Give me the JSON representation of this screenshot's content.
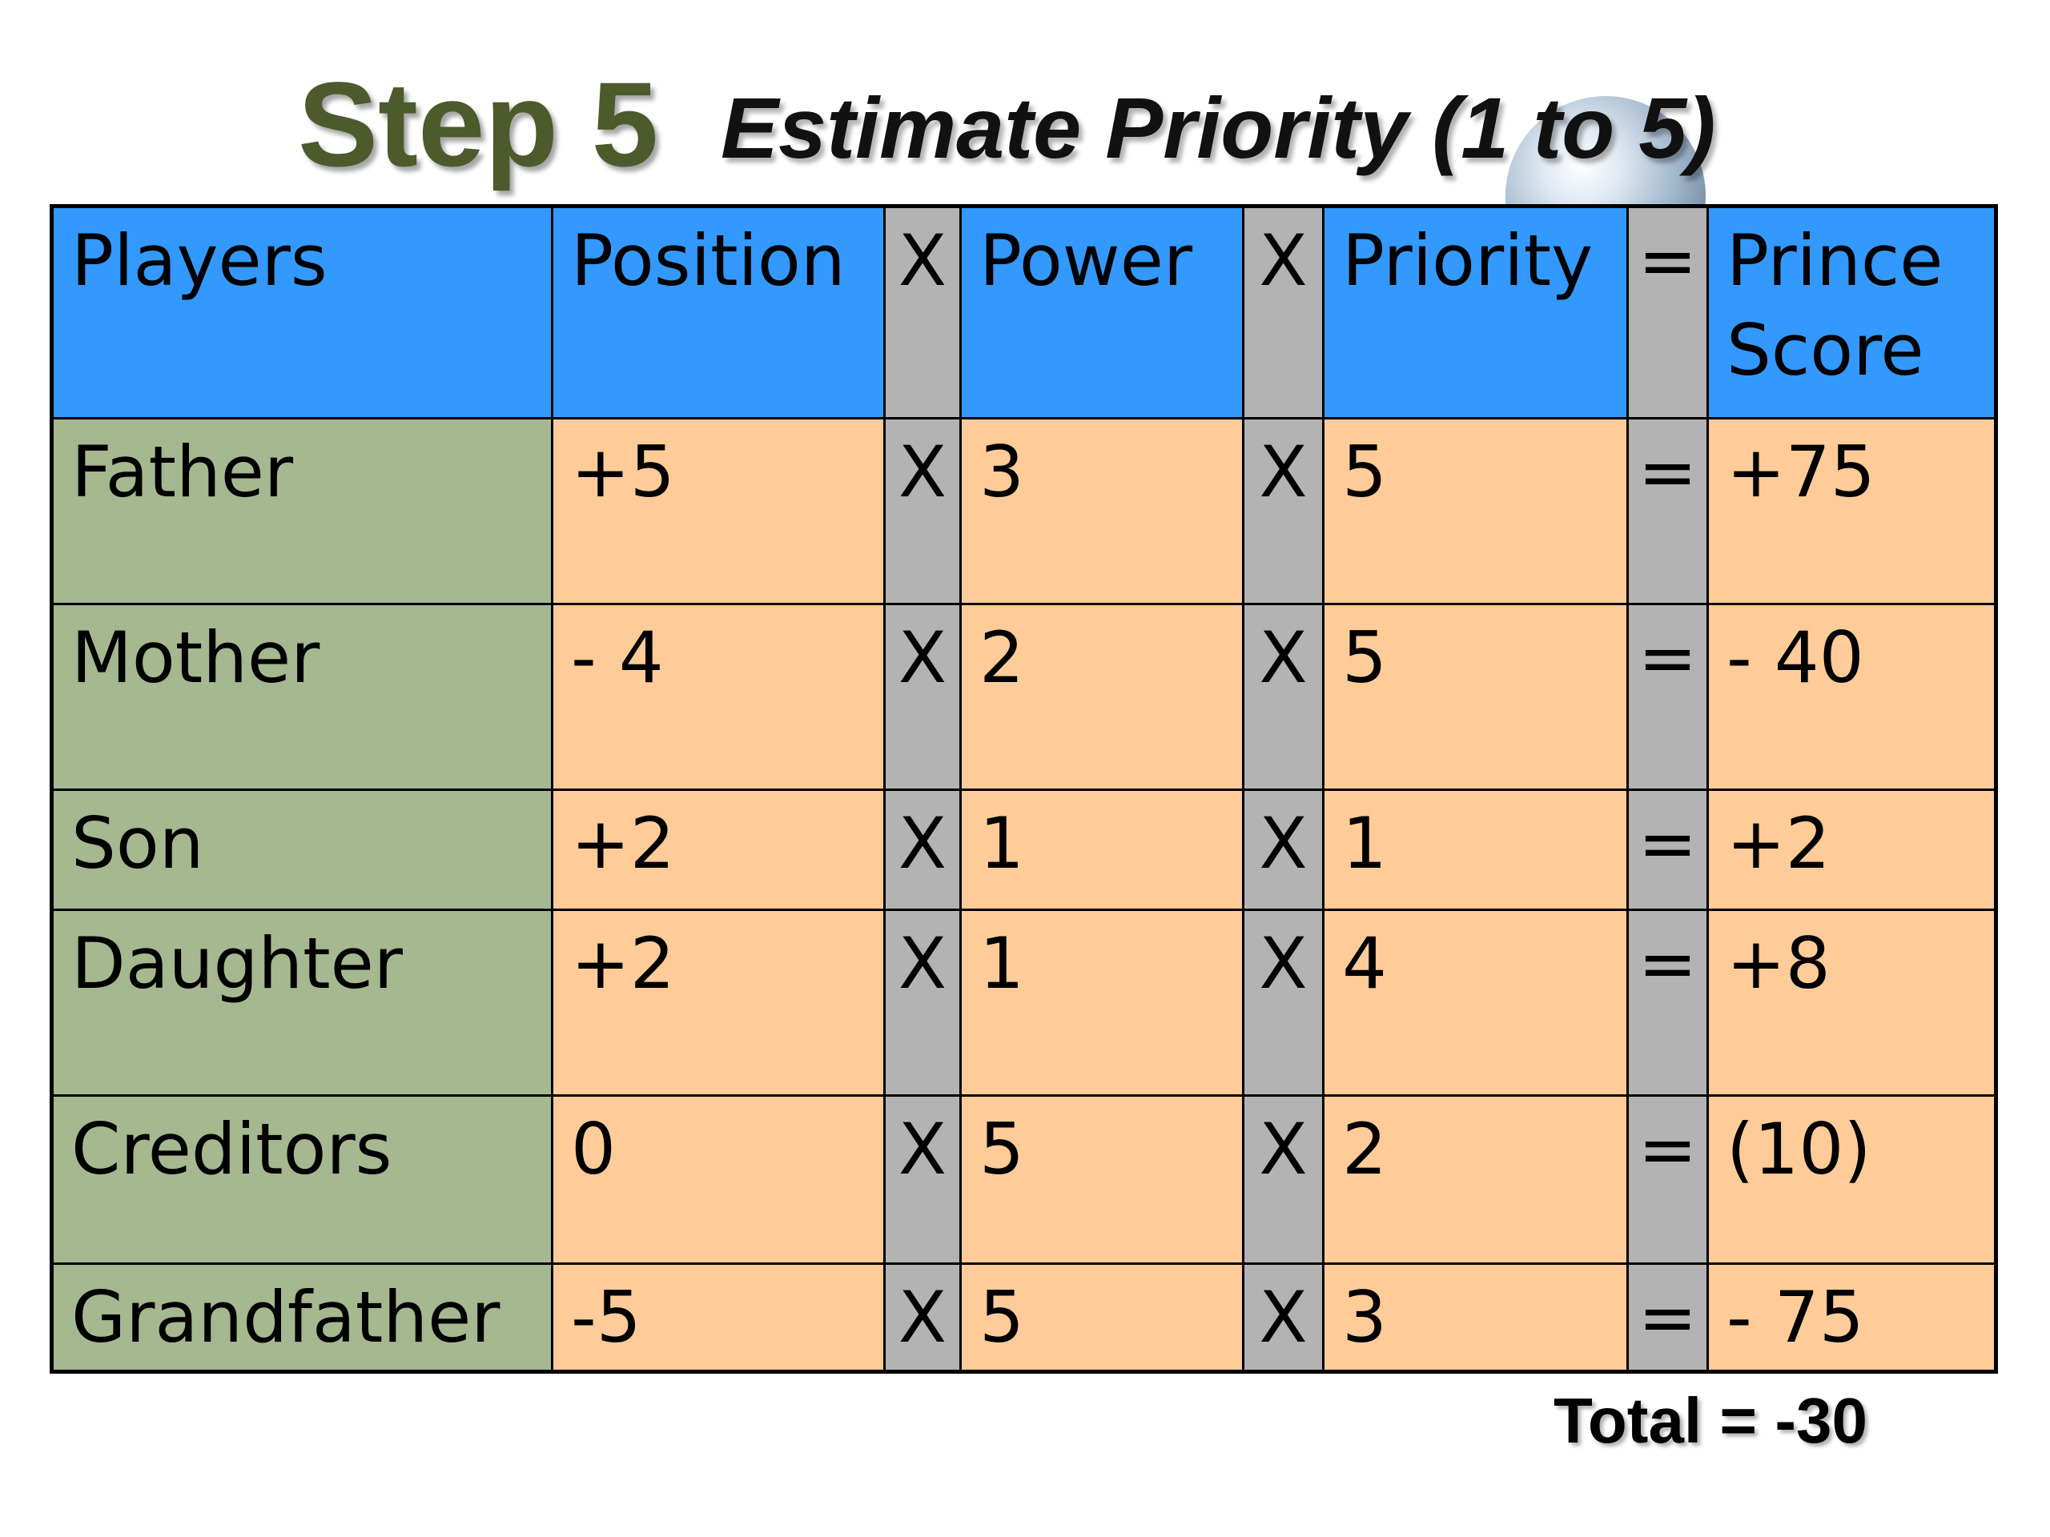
{
  "title": {
    "step": "Step 5",
    "subtitle": "Estimate Priority (1 to 5)"
  },
  "table": {
    "headers": {
      "players": "Players",
      "position": "Position",
      "op1": "X",
      "power": "Power",
      "op2": "X",
      "priority": "Priority",
      "op3": "=",
      "prince_score_line1": "Prince",
      "prince_score_line2": "Score"
    },
    "rows": [
      {
        "player": "Father",
        "position": "+5",
        "op1": "X",
        "power": "3",
        "op2": "X",
        "priority": "5",
        "op3": "=",
        "score": "+75"
      },
      {
        "player": "Mother",
        "position": "- 4",
        "op1": "X",
        "power": "2",
        "op2": "X",
        "priority": "5",
        "op3": "=",
        "score": "- 40"
      },
      {
        "player": "Son",
        "position": "+2",
        "op1": "X",
        "power": "1",
        "op2": "X",
        "priority": "1",
        "op3": "=",
        "score": "+2"
      },
      {
        "player": "Daughter",
        "position": "+2",
        "op1": "X",
        "power": "1",
        "op2": "X",
        "priority": "4",
        "op3": "=",
        "score": "+8"
      },
      {
        "player": "Creditors",
        "position": "0",
        "op1": "X",
        "power": "5",
        "op2": "X",
        "priority": "2",
        "op3": "=",
        "score": "(10)"
      },
      {
        "player": "Grandfather",
        "position": "-5",
        "op1": "X",
        "power": "5",
        "op2": "X",
        "priority": "3",
        "op3": "=",
        "score": "- 75"
      }
    ]
  },
  "total": "Total = -30",
  "colors": {
    "header": "#3399ff",
    "player_cell": "#a5b890",
    "value_cell": "#ffcc99",
    "operator_cell": "#b3b3b3",
    "step_text": "#4c5a2c"
  }
}
